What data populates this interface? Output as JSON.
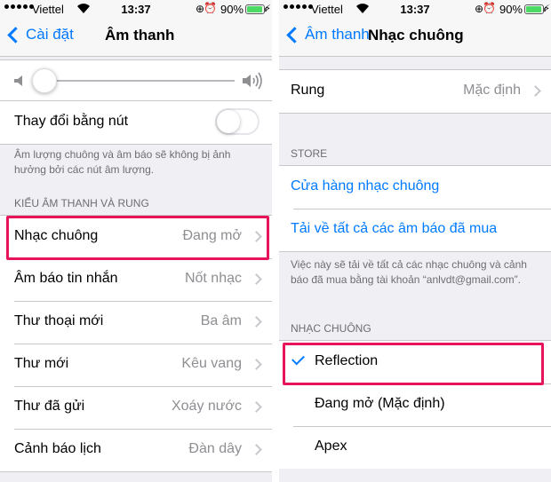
{
  "status_bar": {
    "carrier": "Viettel",
    "time": "13:37",
    "battery": "90%",
    "battery_level": 0.9,
    "icons": [
      "signal-dots-icon",
      "wifi-icon",
      "orientation-lock-icon",
      "alarm-icon",
      "battery-icon",
      "charging-bolt-icon"
    ]
  },
  "left": {
    "nav": {
      "back_label": "Cài đặt",
      "title": "Âm thanh"
    },
    "volume": {
      "level": 0.07,
      "icons": [
        "speaker-low-icon",
        "speaker-high-icon"
      ]
    },
    "change_with_buttons": {
      "label": "Thay đổi bằng nút",
      "on": false
    },
    "change_note": "Âm lượng chuông và âm báo sẽ không bị ảnh hưởng bởi các nút âm lượng.",
    "section_header": "KIỂU ÂM THANH VÀ RUNG",
    "items": [
      {
        "label": "Nhạc chuông",
        "value": "Đang mở"
      },
      {
        "label": "Âm báo tin nhắn",
        "value": "Nốt nhạc"
      },
      {
        "label": "Thư thoại mới",
        "value": "Ba âm"
      },
      {
        "label": "Thư mới",
        "value": "Kêu vang"
      },
      {
        "label": "Thư đã gửi",
        "value": "Xoáy nước"
      },
      {
        "label": "Cảnh báo lịch",
        "value": "Đàn dây"
      }
    ]
  },
  "right": {
    "nav": {
      "back_label": "Âm thanh",
      "title": "Nhạc chuông"
    },
    "vibration": {
      "label": "Rung",
      "value": "Mặc định"
    },
    "store_header": "STORE",
    "store_links": [
      "Cửa hàng nhạc chuông",
      "Tải về tất cả các âm báo đã mua"
    ],
    "store_note": "Việc này sẽ tải về tất cả các nhạc chuông và cảnh báo đã mua bằng tài khoản “anlvdt@gmail.com”.",
    "ringtones_header": "NHẠC CHUÔNG",
    "ringtones": [
      {
        "label": "Reflection",
        "selected": true
      },
      {
        "label": "Đang mở (Mặc định)",
        "selected": false
      },
      {
        "label": "Apex",
        "selected": false
      }
    ]
  },
  "colors": {
    "accent": "#007aff",
    "highlight": "#e8145a",
    "background": "#efeff4",
    "secondary_text": "#8e8e93"
  }
}
